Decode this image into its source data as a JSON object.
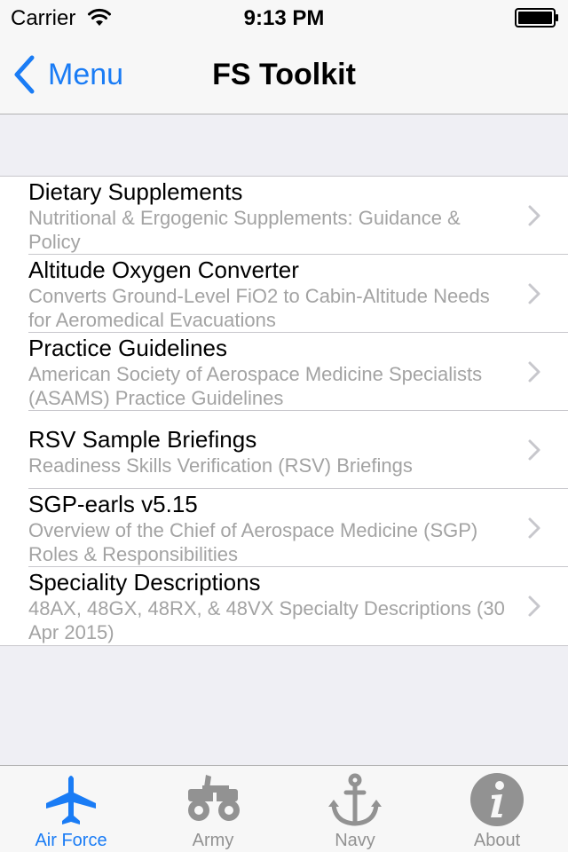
{
  "status_bar": {
    "carrier": "Carrier",
    "time": "9:13 PM"
  },
  "nav_bar": {
    "back_label": "Menu",
    "title": "FS Toolkit"
  },
  "rows": [
    {
      "title": "Dietary Supplements",
      "subtitle": "Nutritional & Ergogenic Supplements: Guidance & Policy"
    },
    {
      "title": "Altitude Oxygen Converter",
      "subtitle": "Converts Ground-Level FiO2 to Cabin-Altitude Needs for Aeromedical Evacuations"
    },
    {
      "title": "Practice Guidelines",
      "subtitle": "American Society of Aerospace Medicine Specialists (ASAMS) Practice Guidelines"
    },
    {
      "title": "RSV Sample Briefings",
      "subtitle": "Readiness Skills Verification (RSV) Briefings"
    },
    {
      "title": "SGP-earls v5.15",
      "subtitle": "Overview of the Chief of Aerospace Medicine (SGP) Roles & Responsibilities"
    },
    {
      "title": "Speciality Descriptions",
      "subtitle": "48AX, 48GX, 48RX, & 48VX Specialty Descriptions (30 Apr 2015)"
    }
  ],
  "tab_bar": {
    "active_tab": "Air Force",
    "tabs": [
      {
        "label": "Air Force",
        "icon": "airplane-icon"
      },
      {
        "label": "Army",
        "icon": "jeep-icon"
      },
      {
        "label": "Navy",
        "icon": "anchor-icon"
      },
      {
        "label": "About",
        "icon": "info-icon"
      }
    ]
  },
  "colors": {
    "accent": "#1a7cf5",
    "inactive": "#929292",
    "subtitle": "#a3a3a3",
    "background": "#efeff4"
  }
}
